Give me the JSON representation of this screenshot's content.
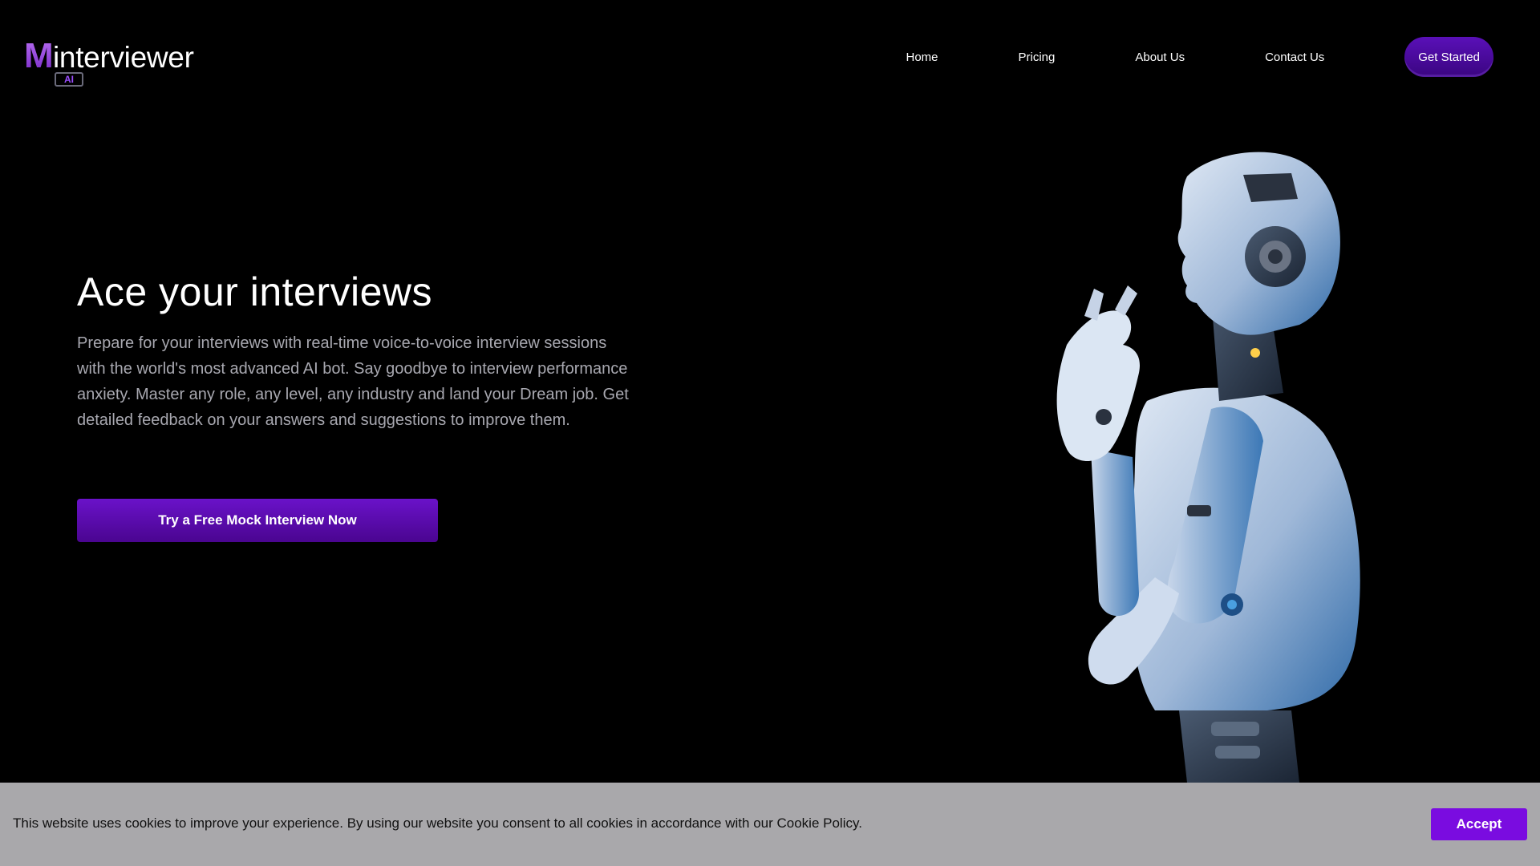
{
  "brand": {
    "logo_letter": "M",
    "logo_word": "interviewer",
    "logo_badge": "AI",
    "accent_color": "#7a0ce0"
  },
  "nav": {
    "links": [
      "Home",
      "Pricing",
      "About Us",
      "Contact Us"
    ],
    "cta_label": "Get Started"
  },
  "hero": {
    "title": "Ace your interviews",
    "description": "Prepare for your interviews with real-time voice-to-voice interview sessions with the world's most advanced AI bot. Say goodbye to interview performance anxiety. Master any role, any level, any industry and land your Dream job. Get detailed feedback on your answers and suggestions to improve them.",
    "cta_label": "Try a Free Mock Interview Now",
    "image": "humanoid-robot-illustration"
  },
  "cookie_banner": {
    "message": "This website uses cookies to improve your experience. By using our website you consent to all cookies in accordance with our Cookie Policy.",
    "accept_label": "Accept"
  }
}
